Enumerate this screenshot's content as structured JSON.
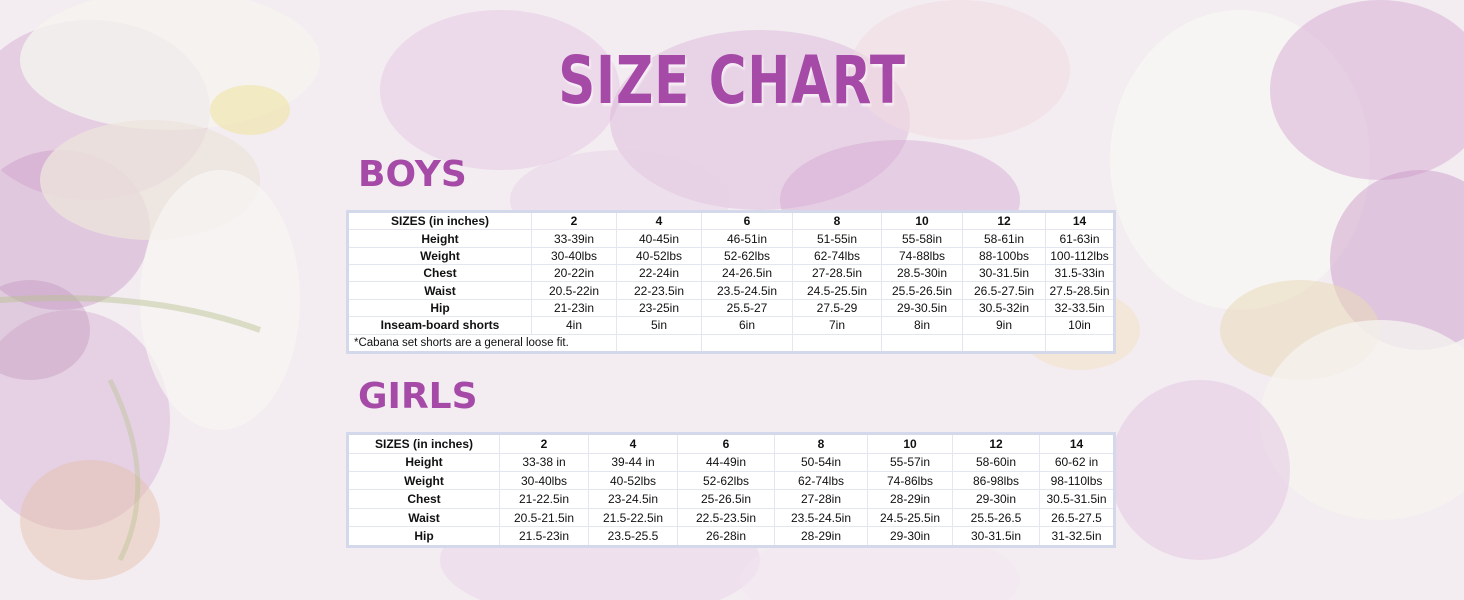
{
  "title": "SIZE CHART",
  "boys": {
    "heading": "BOYS",
    "header": [
      "SIZES (in inches)",
      "2",
      "4",
      "6",
      "8",
      "10",
      "12",
      "14"
    ],
    "rows": [
      {
        "label": "Height",
        "values": [
          "33-39in",
          "40-45in",
          "46-51in",
          "51-55in",
          "55-58in",
          "58-61in",
          "61-63in"
        ]
      },
      {
        "label": "Weight",
        "values": [
          "30-40lbs",
          "40-52lbs",
          "52-62lbs",
          "62-74lbs",
          "74-88lbs",
          "88-100bs",
          "100-112lbs"
        ]
      },
      {
        "label": "Chest",
        "values": [
          "20-22in",
          "22-24in",
          "24-26.5in",
          "27-28.5in",
          "28.5-30in",
          "30-31.5in",
          "31.5-33in"
        ]
      },
      {
        "label": "Waist",
        "values": [
          "20.5-22in",
          "22-23.5in",
          "23.5-24.5in",
          "24.5-25.5in",
          "25.5-26.5in",
          "26.5-27.5in",
          "27.5-28.5in"
        ]
      },
      {
        "label": "Hip",
        "values": [
          "21-23in",
          "23-25in",
          "25.5-27",
          "27.5-29",
          "29-30.5in",
          "30.5-32in",
          "32-33.5in"
        ]
      },
      {
        "label": "Inseam-board shorts",
        "values": [
          "4in",
          "5in",
          "6in",
          "7in",
          "8in",
          "9in",
          "10in"
        ]
      }
    ],
    "note": "*Cabana set shorts are a general loose fit."
  },
  "girls": {
    "heading": "GIRLS",
    "header": [
      "SIZES (in inches)",
      "2",
      "4",
      "6",
      "8",
      "10",
      "12",
      "14"
    ],
    "rows": [
      {
        "label": "Height",
        "values": [
          "33-38 in",
          "39-44 in",
          "44-49in",
          "50-54in",
          "55-57in",
          "58-60in",
          "60-62 in"
        ]
      },
      {
        "label": "Weight",
        "values": [
          "30-40lbs",
          "40-52lbs",
          "52-62lbs",
          "62-74lbs",
          "74-86lbs",
          "86-98lbs",
          "98-110lbs"
        ]
      },
      {
        "label": "Chest",
        "values": [
          "21-22.5in",
          "23-24.5in",
          "25-26.5in",
          "27-28in",
          "28-29in",
          "29-30in",
          "30.5-31.5in"
        ]
      },
      {
        "label": "Waist",
        "values": [
          "20.5-21.5in",
          "21.5-22.5in",
          "22.5-23.5in",
          "23.5-24.5in",
          "24.5-25.5in",
          "25.5-26.5",
          "26.5-27.5"
        ]
      },
      {
        "label": "Hip",
        "values": [
          "21.5-23in",
          "23.5-25.5",
          "26-28in",
          "28-29in",
          "29-30in",
          "30-31.5in",
          "31-32.5in"
        ]
      }
    ]
  },
  "colors": {
    "accent": "#a64aa8",
    "table_border": "#d3d9ea"
  }
}
